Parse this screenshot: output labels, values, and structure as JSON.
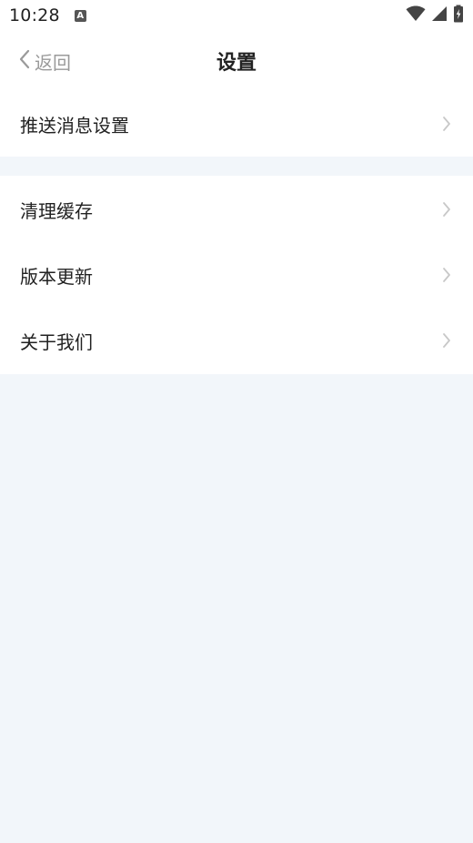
{
  "status_bar": {
    "time": "10:28",
    "app_icon_glyph": "A"
  },
  "header": {
    "back_label": "返回",
    "title": "设置"
  },
  "settings": {
    "group1": [
      {
        "label": "推送消息设置"
      }
    ],
    "group2": [
      {
        "label": "清理缓存"
      },
      {
        "label": "版本更新"
      },
      {
        "label": "关于我们"
      }
    ]
  },
  "icons": {
    "back": "chevron-left-icon",
    "row_arrow": "chevron-right-icon",
    "wifi": "wifi-icon",
    "signal": "signal-icon",
    "battery": "battery-icon"
  },
  "colors": {
    "page_background": "#f2f6fa",
    "card_background": "#ffffff",
    "text_primary": "#222222",
    "text_secondary": "#9a9a9a",
    "chevron": "#c8c8c8"
  }
}
